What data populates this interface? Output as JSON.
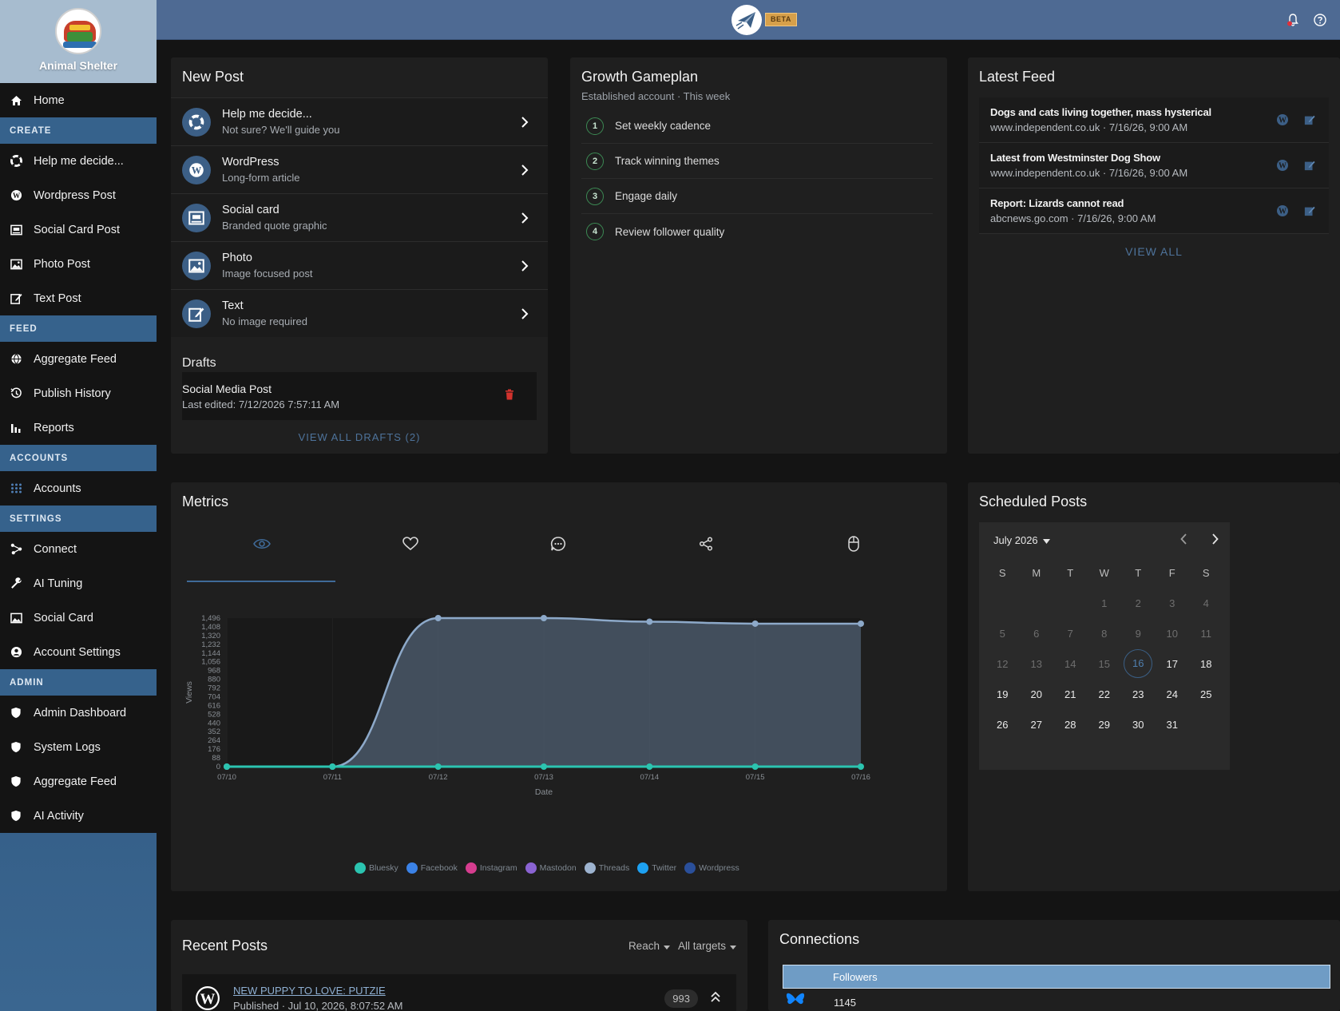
{
  "sidebar": {
    "org_name": "Animal Shelter",
    "home": "Home",
    "sections": {
      "create": "CREATE",
      "feed": "FEED",
      "accounts": "ACCOUNTS",
      "settings": "SETTINGS",
      "admin": "ADMIN"
    },
    "create_items": [
      "Help me decide...",
      "Wordpress Post",
      "Social Card Post",
      "Photo Post",
      "Text Post"
    ],
    "feed_items": [
      "Aggregate Feed",
      "Publish History",
      "Reports"
    ],
    "accounts_items": [
      "Accounts"
    ],
    "settings_items": [
      "Connect",
      "AI Tuning",
      "Social Card",
      "Account Settings"
    ],
    "admin_items": [
      "Admin Dashboard",
      "System Logs",
      "Aggregate Feed",
      "AI Activity"
    ]
  },
  "topbar": {
    "badge": "BETA"
  },
  "new_post": {
    "title": "New Post",
    "items": [
      {
        "name": "Help me decide...",
        "desc": "Not sure? We'll guide you"
      },
      {
        "name": "WordPress",
        "desc": "Long-form article"
      },
      {
        "name": "Social card",
        "desc": "Branded quote graphic"
      },
      {
        "name": "Photo",
        "desc": "Image focused post"
      },
      {
        "name": "Text",
        "desc": "No image required"
      }
    ],
    "drafts_title": "Drafts",
    "draft": {
      "name": "Social Media Post",
      "edited": "Last edited: 7/12/2026 7:57:11 AM"
    },
    "view_all_drafts": "VIEW ALL DRAFTS (2)"
  },
  "growth": {
    "title": "Growth Gameplan",
    "subtitle": "Established account · This week",
    "steps": [
      "Set weekly cadence",
      "Track winning themes",
      "Engage daily",
      "Review follower quality"
    ]
  },
  "latest_feed": {
    "title": "Latest Feed",
    "items": [
      {
        "title": "Dogs and cats living together, mass hysterical",
        "meta": "www.independent.co.uk · 7/16/26, 9:00 AM"
      },
      {
        "title": "Latest from Westminster Dog Show",
        "meta": "www.independent.co.uk · 7/16/26, 9:00 AM"
      },
      {
        "title": "Report: Lizards cannot read",
        "meta": "abcnews.go.com · 7/16/26, 9:00 AM"
      }
    ],
    "view_all": "VIEW ALL"
  },
  "metrics": {
    "title": "Metrics",
    "tabs": [
      "eye-icon",
      "heart-icon",
      "comment-icon",
      "share-icon",
      "mouse-icon"
    ]
  },
  "chart_data": {
    "type": "area",
    "xlabel": "Date",
    "ylabel": "Views",
    "x": [
      "07/10",
      "07/11",
      "07/12",
      "07/13",
      "07/14",
      "07/15",
      "07/16"
    ],
    "ylim": [
      0,
      1496
    ],
    "yticks": [
      "1,496",
      "1,408",
      "1,320",
      "1,232",
      "1,144",
      "1,056",
      "968",
      "880",
      "792",
      "704",
      "616",
      "528",
      "440",
      "352",
      "264",
      "176",
      "88",
      "0"
    ],
    "series": [
      {
        "name": "Threads",
        "color": "#8da9c9",
        "values": [
          0,
          0,
          1496,
          1496,
          1460,
          1440,
          1440
        ]
      },
      {
        "name": "Bluesky",
        "color": "#2bc4b0",
        "values": [
          0,
          0,
          0,
          0,
          0,
          0,
          0
        ]
      }
    ],
    "legend": [
      {
        "name": "Bluesky",
        "color": "#2bc4b0"
      },
      {
        "name": "Facebook",
        "color": "#3b82e6"
      },
      {
        "name": "Instagram",
        "color": "#d63d8f"
      },
      {
        "name": "Mastodon",
        "color": "#8a63d2"
      },
      {
        "name": "Threads",
        "color": "#9db3cf"
      },
      {
        "name": "Twitter",
        "color": "#1da1f2"
      },
      {
        "name": "Wordpress",
        "color": "#2a4f9a"
      }
    ]
  },
  "scheduled": {
    "title": "Scheduled Posts",
    "month": "July 2026",
    "dow": [
      "S",
      "M",
      "T",
      "W",
      "T",
      "F",
      "S"
    ],
    "weeks": [
      [
        "",
        "",
        "",
        "1",
        "2",
        "3",
        "4"
      ],
      [
        "5",
        "6",
        "7",
        "8",
        "9",
        "10",
        "11"
      ],
      [
        "12",
        "13",
        "14",
        "15",
        "16",
        "17",
        "18"
      ],
      [
        "19",
        "20",
        "21",
        "22",
        "23",
        "24",
        "25"
      ],
      [
        "26",
        "27",
        "28",
        "29",
        "30",
        "31",
        ""
      ]
    ],
    "today": "16"
  },
  "recent": {
    "title": "Recent Posts",
    "filter_reach": "Reach",
    "filter_targets": "All targets",
    "post": {
      "title": "NEW PUPPY TO LOVE: PUTZIE",
      "meta": "Published · Jul 10, 2026, 8:07:52 AM",
      "count": "993"
    }
  },
  "connections": {
    "title": "Connections",
    "header": "Followers",
    "rows": [
      {
        "value": "1145"
      }
    ]
  }
}
